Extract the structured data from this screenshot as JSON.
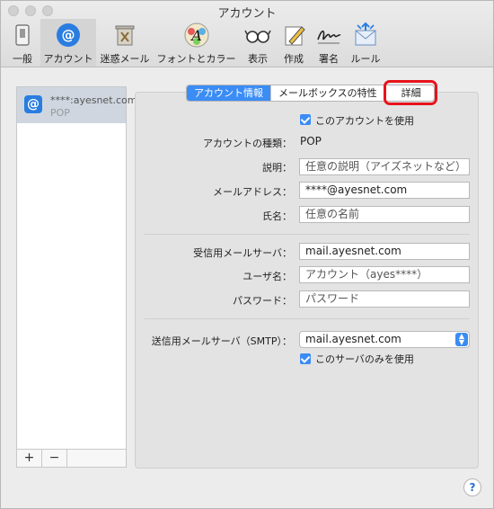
{
  "window": {
    "title": "アカウント"
  },
  "toolbar": {
    "items": [
      {
        "label": "一般",
        "icon": "switch-icon"
      },
      {
        "label": "アカウント",
        "icon": "at-icon"
      },
      {
        "label": "迷惑メール",
        "icon": "trash-icon"
      },
      {
        "label": "フォントとカラー",
        "icon": "font-icon"
      },
      {
        "label": "表示",
        "icon": "glasses-icon"
      },
      {
        "label": "作成",
        "icon": "compose-icon"
      },
      {
        "label": "署名",
        "icon": "signature-icon"
      },
      {
        "label": "ルール",
        "icon": "rules-icon"
      }
    ]
  },
  "accounts": [
    {
      "name": "****:ayesnet.com",
      "type": "POP"
    }
  ],
  "list_controls": {
    "add": "+",
    "remove": "−"
  },
  "tabs": [
    {
      "label": "アカウント情報",
      "selected": true
    },
    {
      "label": "メールボックスの特性",
      "selected": false
    },
    {
      "label": "詳細",
      "selected": false
    }
  ],
  "account_info": {
    "enable_label": "このアカウントを使用",
    "type_label": "アカウントの種類：",
    "type_value": "POP",
    "description_label": "説明：",
    "description_value": "任意の説明（アイズネットなど）",
    "email_label": "メールアドレス：",
    "email_value": "****@ayesnet.com",
    "name_label": "氏名：",
    "name_value": "任意の名前",
    "incoming_label": "受信用メールサーバ：",
    "incoming_value": "mail.ayesnet.com",
    "username_label": "ユーザ名：",
    "username_value": "アカウント（ayes****）",
    "password_label": "パスワード：",
    "password_value": "パスワード",
    "smtp_label": "送信用メールサーバ（SMTP）：",
    "smtp_value": "mail.ayesnet.com",
    "smtp_only_label": "このサーバのみを使用"
  },
  "help": "?",
  "colors": {
    "accent": "#3b8cf5",
    "highlight": "#e8131b"
  }
}
